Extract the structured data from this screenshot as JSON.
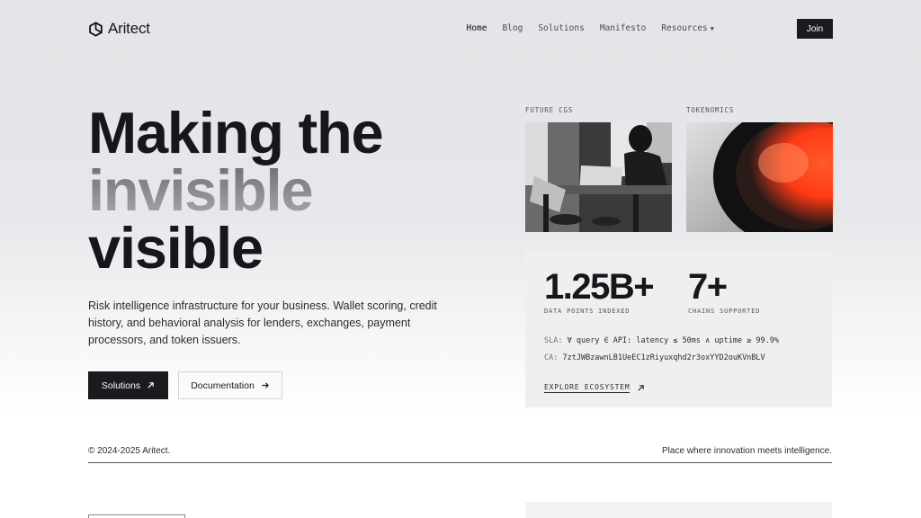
{
  "brand": {
    "name": "Aritect"
  },
  "nav": {
    "items": [
      "Home",
      "Blog",
      "Solutions",
      "Manifesto"
    ],
    "resources": "Resources",
    "join": "Join"
  },
  "hero": {
    "line1": "Making the",
    "line2": "invisible",
    "line3": "visible",
    "subtitle": "Risk intelligence infrastructure for your business. Wallet scoring, credit history, and behavioral analysis for lenders, exchanges, payment processors, and token issuers.",
    "primary_button": "Solutions",
    "secondary_button": "Documentation"
  },
  "cards": {
    "future_label": "FUTURE CGS",
    "tokenomics_label": "TOKENOMICS"
  },
  "stats": {
    "data_points": "1.25B+",
    "data_points_label": "DATA POINTS INDEXED",
    "chains": "7+",
    "chains_label": "CHAINS SUPPORTED",
    "sla_key": "SLA:",
    "sla_value": "∀ query ∈ API: latency ≤ 50ms ∧ uptime ≥ 99.9%",
    "ca_key": "CA:",
    "ca_value": "7ztJWBzawnLB1UeEC1zRiyuxqhd2r3oxYYD2ouKVnBLV",
    "explore": "EXPLORE ECOSYSTEM"
  },
  "footer": {
    "copyright": "© 2024-2025 Aritect.",
    "tagline": "Place where innovation meets intelligence."
  },
  "colors": {
    "accent_dark": "#1a1b1f",
    "token_orange": "#ff3a14"
  },
  "icons": {
    "logo": "hexagon-logo-icon",
    "arrow_up_right": "arrow-up-right-icon",
    "arrow_right": "arrow-right-icon",
    "caret": "chevron-down-icon"
  }
}
